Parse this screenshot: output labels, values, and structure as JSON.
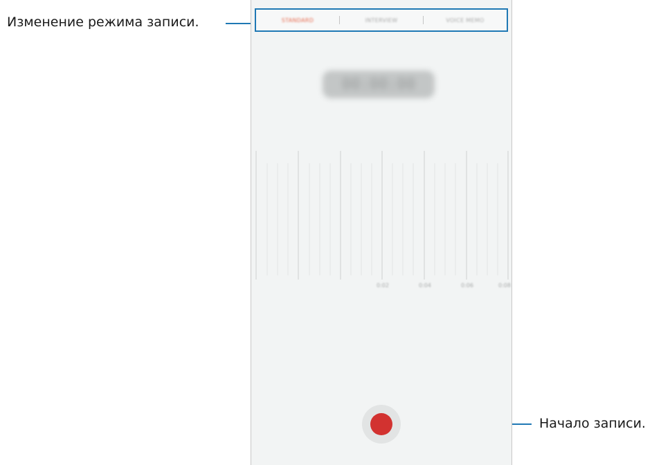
{
  "callouts": {
    "change_mode": "Изменение режима записи.",
    "start_recording": "Начало записи."
  },
  "mode_bar": {
    "tabs": [
      {
        "label": "STANDARD",
        "active": true
      },
      {
        "label": "INTERVIEW",
        "active": false
      },
      {
        "label": "VOICE MEMO",
        "active": false
      }
    ]
  },
  "timer": {
    "value": "00:00:00"
  },
  "waveform": {
    "time_labels": [
      "0:02",
      "0:04",
      "0:06",
      "0:08"
    ]
  },
  "colors": {
    "callout_line": "#1f78b4",
    "active_tab": "#e86a4e",
    "record_button": "#d23230",
    "screen_background": "#f2f4f4"
  }
}
